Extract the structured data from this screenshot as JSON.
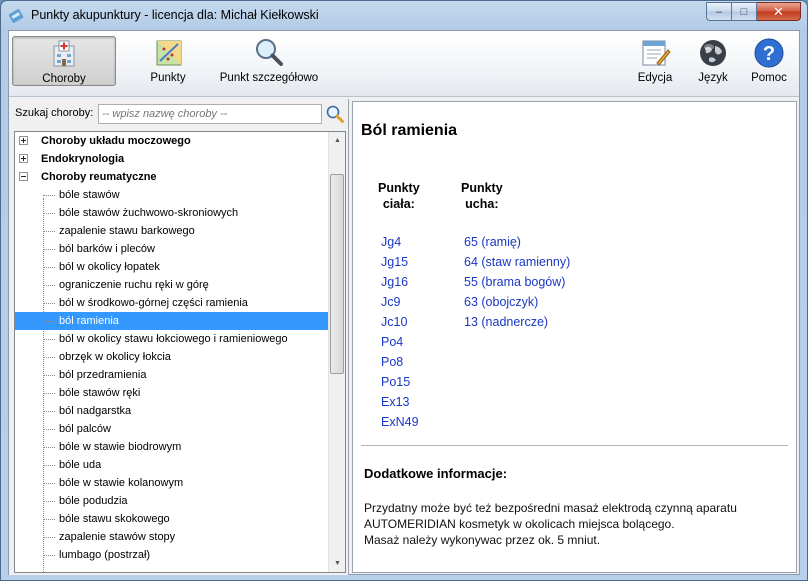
{
  "window": {
    "title": "Punkty akupunktury - licencja dla: Michał Kiełkowski",
    "controls": {
      "minimize": "–",
      "maximize": "□",
      "close": "✕"
    }
  },
  "toolbar": {
    "choroby": "Choroby",
    "punkty": "Punkty",
    "punkt_szczegolowo": "Punkt szczegółowo",
    "edycja": "Edycja",
    "jezyk": "Język",
    "pomoc": "Pomoc"
  },
  "search": {
    "label": "Szukaj choroby:",
    "placeholder": "-- wpisz nazwę choroby --"
  },
  "tree": {
    "categories": [
      {
        "label": "Choroby układu moczowego",
        "expanded": false
      },
      {
        "label": "Endokrynologia",
        "expanded": false
      },
      {
        "label": "Choroby reumatyczne",
        "expanded": true
      }
    ],
    "children": [
      "bóle stawów",
      "bóle stawów żuchwowo-skroniowych",
      "zapalenie stawu barkowego",
      "ból barków i pleców",
      "ból w okolicy łopatek",
      "ograniczenie ruchu ręki w górę",
      "ból w środkowo-górnej części ramienia",
      "ból ramienia",
      "ból w okolicy stawu łokciowego i ramieniowego",
      "obrzęk w okolicy łokcia",
      "ból przedramienia",
      "bóle stawów ręki",
      "ból nadgarstka",
      "ból palców",
      "bóle w stawie biodrowym",
      "bóle uda",
      "bóle w stawie kolanowym",
      "bóle podudzia",
      "bóle stawu skokowego",
      "zapalenie stawów stopy",
      "lumbago (postrzał)"
    ],
    "selected": "ból ramienia"
  },
  "detail": {
    "title": "Ból ramienia",
    "body_points_header": [
      "Punkty",
      "ciała:"
    ],
    "ear_points_header": [
      "Punkty",
      "ucha:"
    ],
    "body_points": [
      "Jg4",
      "Jg15",
      "Jg16",
      "Jc9",
      "Jc10",
      "Po4",
      "Po8",
      "Po15",
      "Ex13",
      "ExN49"
    ],
    "ear_points": [
      "65 (ramię)",
      "64 (staw ramienny)",
      "55 (brama bogów)",
      "63 (obojczyk)",
      "13 (nadnercze)"
    ],
    "extra_title": "Dodatkowe informacje:",
    "extra_lines": [
      "Przydatny może być też bezpośredni masaż elektrodą czynną aparatu",
      "AUTOMERIDIAN kosmetyk w okolicach miejsca bolącego.",
      "Masaż należy wykonywac przez ok. 5 mniut."
    ]
  },
  "colors": {
    "link": "#1a37c5",
    "selection": "#3399ff"
  }
}
